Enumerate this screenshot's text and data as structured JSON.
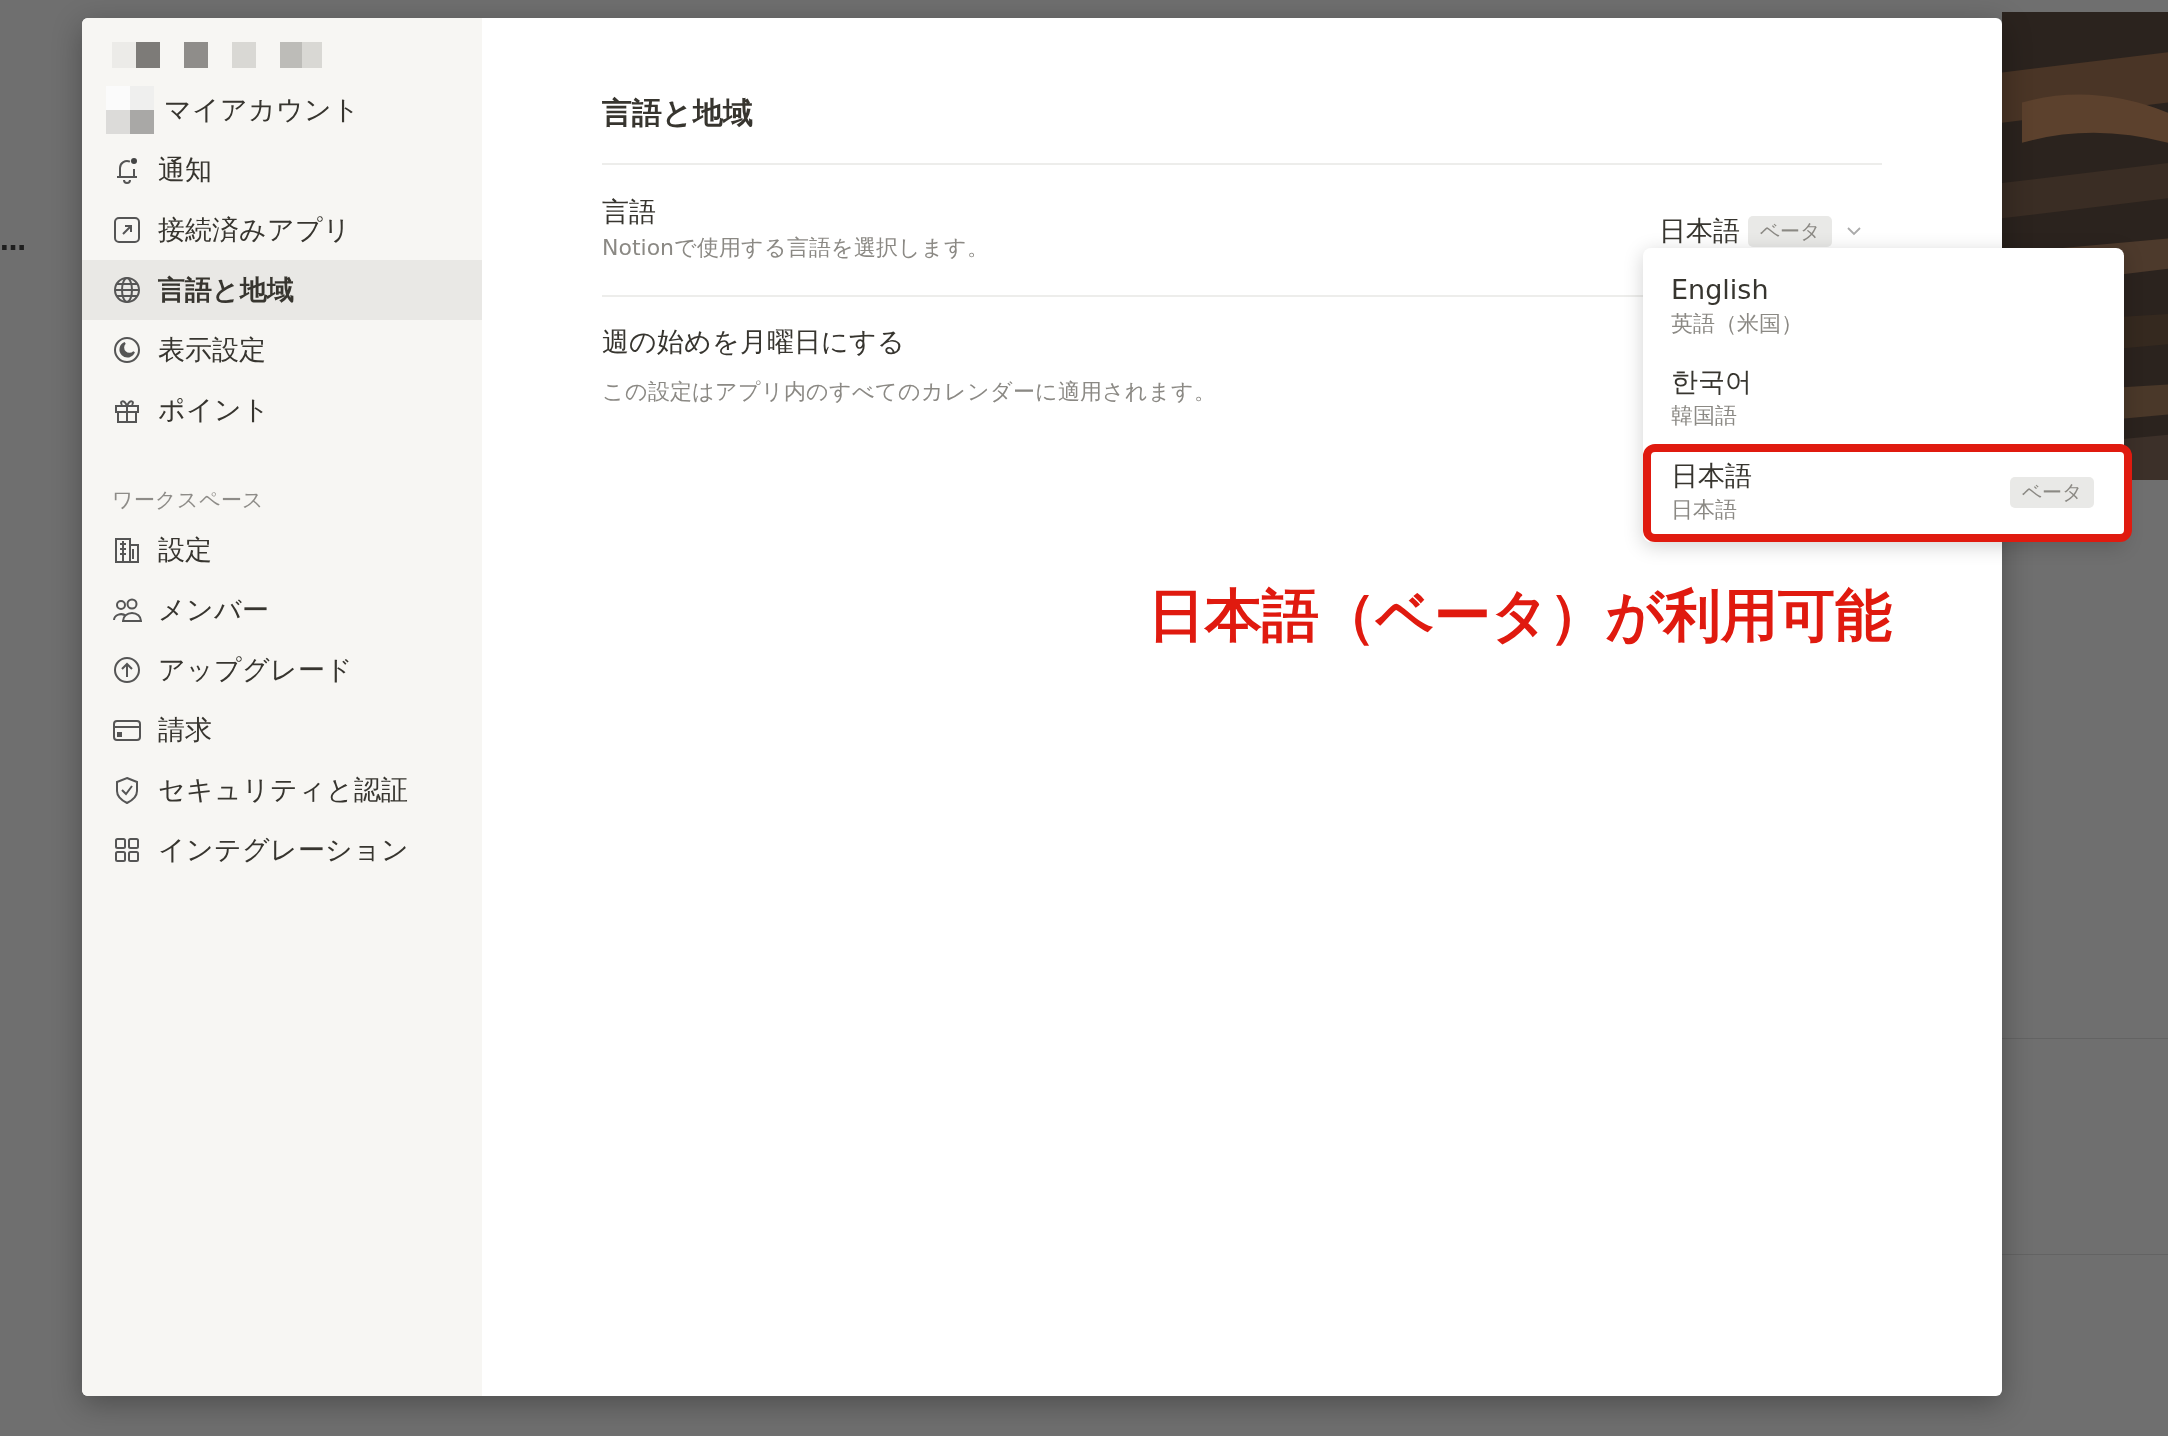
{
  "background": {
    "text": "…"
  },
  "sidebar": {
    "account_items": [
      {
        "label": "マイアカウント",
        "selected": false
      },
      {
        "label": "通知",
        "selected": false
      },
      {
        "label": "接続済みアプリ",
        "selected": false
      },
      {
        "label": "言語と地域",
        "selected": true
      },
      {
        "label": "表示設定",
        "selected": false
      },
      {
        "label": "ポイント",
        "selected": false
      }
    ],
    "section_label": "ワークスペース",
    "workspace_items": [
      {
        "label": "設定",
        "selected": false
      },
      {
        "label": "メンバー",
        "selected": false
      },
      {
        "label": "アップグレード",
        "selected": false
      },
      {
        "label": "請求",
        "selected": false
      },
      {
        "label": "セキュリティと認証",
        "selected": false
      },
      {
        "label": "インテグレーション",
        "selected": false
      }
    ]
  },
  "main": {
    "title": "言語と地域",
    "settings": [
      {
        "label": "言語",
        "description": "Notionで使用する言語を選択します。"
      },
      {
        "label": "週の始めを月曜日にする",
        "description": "この設定はアプリ内のすべてのカレンダーに適用されます。"
      }
    ],
    "language_select": {
      "value": "日本語",
      "badge": "ベータ"
    },
    "dropdown": {
      "options": [
        {
          "name": "English",
          "native": "英語（米国）",
          "highlighted": false
        },
        {
          "name": "한국어",
          "native": "韓国語",
          "highlighted": false
        },
        {
          "name": "日本語",
          "native": "日本語",
          "badge": "ベータ",
          "highlighted": true
        }
      ]
    }
  },
  "annotation": {
    "text": "日本語（ベータ）が利用可能"
  }
}
